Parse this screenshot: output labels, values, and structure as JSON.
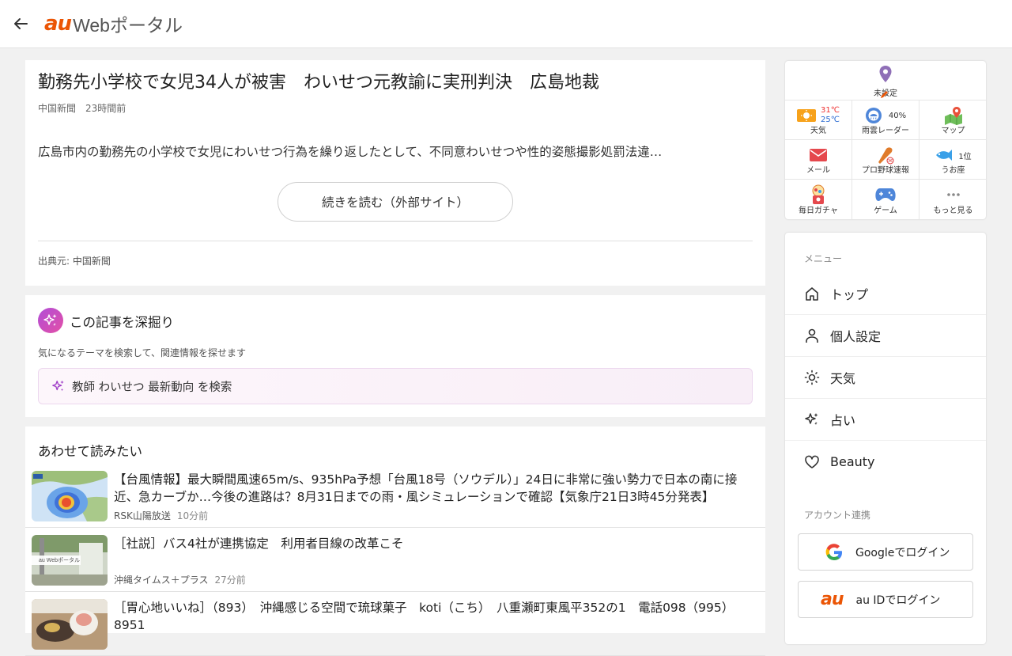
{
  "header": {
    "logo_au": "au",
    "logo_text": "Webポータル"
  },
  "article": {
    "title": "勤務先小学校で女児34人が被害　わいせつ元教諭に実刑判決　広島地裁",
    "source_name": "中国新聞",
    "time": "23時間前",
    "lead": "広島市内の勤務先の小学校で女児にわいせつ行為を繰り返したとして、不同意わいせつや性的姿態撮影処罰法違…",
    "read_more_label": "続きを読む（外部サイト）",
    "credit": "出典元: 中国新聞"
  },
  "deep_dive": {
    "title": "この記事を深掘り",
    "description": "気になるテーマを検索して、関連情報を探せます",
    "search_label": "教師 わいせつ 最新動向 を検索"
  },
  "related": {
    "title": "あわせて読みたい",
    "items": [
      {
        "title": "【台風情報】最大瞬間風速65m/s、935hPa予想「台風18号（ソウデル）」24日に非常に強い勢力で日本の南に接近、急カーブか…今後の進路は？8月31日までの雨・風シミュレーションで確認【気象庁21日3時45分発表】",
        "source": "RSK山陽放送",
        "time": "10分前"
      },
      {
        "title": "［社説］バス4社が連携協定　利用者目線の改革こそ",
        "source": "沖縄タイムス＋プラス",
        "time": "27分前",
        "thumb_text": "au Webポータル"
      },
      {
        "title": "［胃心地いいね］（893）　沖縄感じる空間で琉球菓子　koti（こち）　八重瀬町東風平352の1　電話098（995）8951",
        "source": "",
        "time": ""
      }
    ]
  },
  "widget": {
    "location_label": "未設定",
    "weather": {
      "high": "31℃",
      "low": "25℃",
      "label": "天気"
    },
    "rain_radar": {
      "percent": "40%",
      "label": "雨雲レーダー"
    },
    "map_label": "マップ",
    "mail_label": "メール",
    "baseball_label": "プロ野球速報",
    "horoscope": {
      "rank": "1位",
      "label": "うお座"
    },
    "gacha_label": "毎日ガチャ",
    "game_label": "ゲーム",
    "more_label": "もっと見る"
  },
  "menu": {
    "heading": "メニュー",
    "items": [
      {
        "label": "トップ",
        "icon": "home-icon"
      },
      {
        "label": "個人設定",
        "icon": "person-icon"
      },
      {
        "label": "天気",
        "icon": "sun-icon"
      },
      {
        "label": "占い",
        "icon": "sparkle-icon"
      },
      {
        "label": "Beauty",
        "icon": "heart-icon"
      }
    ],
    "account_heading": "アカウント連携",
    "google_login": "Googleでログイン",
    "au_login": "au IDでログイン",
    "au_logo": "au"
  },
  "colors": {
    "brand": "#eb5505",
    "deep_dive_gradient": [
      "#b14ed8",
      "#e34fa6"
    ]
  }
}
